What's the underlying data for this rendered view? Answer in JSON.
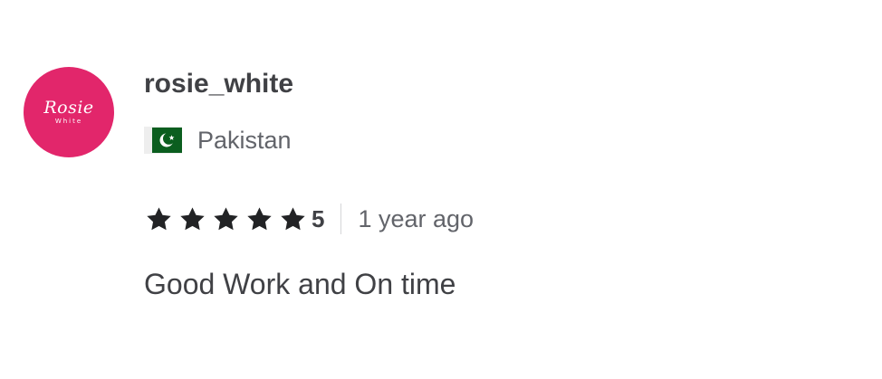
{
  "reviewer": {
    "username": "rosie_white",
    "avatar": {
      "script_text": "Rosie",
      "sub_text": "White",
      "background_color": "#e2266b"
    },
    "country": {
      "name": "Pakistan",
      "flag_icon": "pakistan-flag-icon"
    }
  },
  "rating": {
    "value": "5",
    "stars": 5,
    "max_stars": 5,
    "star_color": "#222325",
    "star_icon": "star-icon"
  },
  "time_ago": "1 year ago",
  "review_text": "Good Work and On time"
}
